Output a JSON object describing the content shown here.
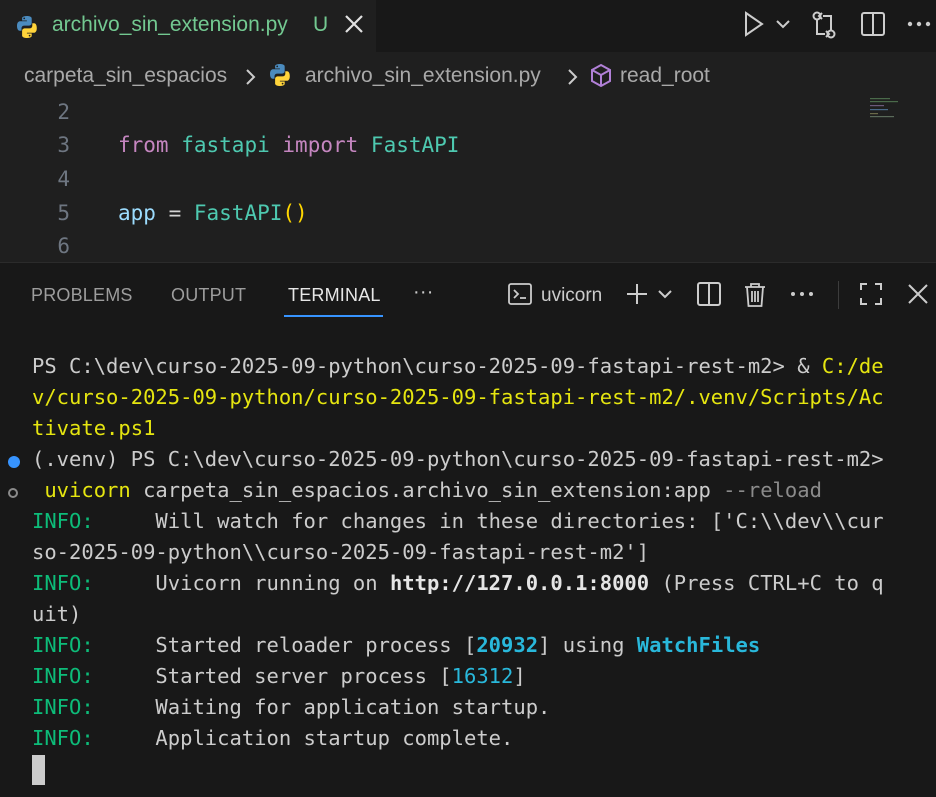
{
  "tab": {
    "filename": "archivo_sin_extension.py",
    "status": "U"
  },
  "breadcrumb": {
    "folder": "carpeta_sin_espacios",
    "file": "archivo_sin_extension.py",
    "symbol": "read_root"
  },
  "editor": {
    "lines": [
      {
        "num": "2"
      },
      {
        "num": "3",
        "kw1": "from",
        "mod": "fastapi",
        "kw2": "import",
        "cls": "FastAPI"
      },
      {
        "num": "4"
      },
      {
        "num": "5",
        "var": "app",
        "op": " = ",
        "cls": "FastAPI",
        "paren": "()"
      },
      {
        "num": "6"
      }
    ]
  },
  "panel": {
    "tabs": [
      "PROBLEMS",
      "OUTPUT",
      "TERMINAL"
    ],
    "more": "···",
    "terminal_name": "uvicorn"
  },
  "terminal": {
    "l1_prompt": "PS C:\\dev\\curso-2025-09-python\\curso-2025-09-fastapi-rest-m2> ",
    "l1_amp": "&",
    "l1_path_a": " C:/de",
    "l2": "v/curso-2025-09-python/curso-2025-09-fastapi-rest-m2/.venv/Scripts/Ac",
    "l3": "tivate.ps1",
    "l4": "(.venv) PS C:\\dev\\curso-2025-09-python\\curso-2025-09-fastapi-rest-m2>",
    "l5_cmd": " uvicorn",
    "l5_args": " carpeta_sin_espacios.archivo_sin_extension:app ",
    "l5_flag": "--reload",
    "info_label": "INFO:",
    "l6_text": "     Will watch for changes in these directories: ['C:\\\\dev\\\\cur",
    "l7": "so-2025-09-python\\\\curso-2025-09-fastapi-rest-m2']",
    "l8_text": "     Uvicorn running on ",
    "l8_url": "http://127.0.0.1:8000",
    "l8_rest": " (Press CTRL+C to q",
    "l9": "uit)",
    "l10_text": "     Started reloader process [",
    "l10_pid": "20932",
    "l10_mid": "] using ",
    "l10_watch": "WatchFiles",
    "l11_text": "     Started server process [",
    "l11_pid": "16312",
    "l11_end": "]",
    "l12_text": "     Waiting for application startup.",
    "l13_text": "     Application startup complete."
  },
  "colors": {
    "accent": "#3794ff",
    "untracked": "#73c991",
    "info": "#0dbc79"
  }
}
